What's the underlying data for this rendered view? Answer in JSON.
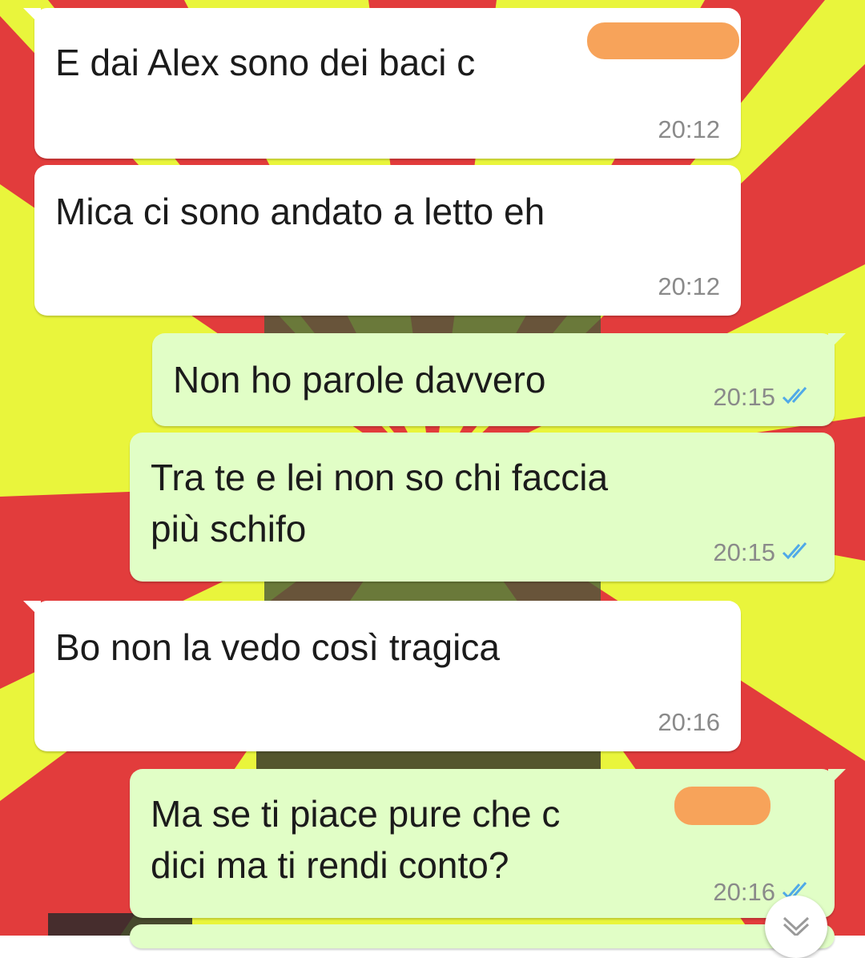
{
  "colors": {
    "wallpaper_yellow": "#e9f53c",
    "wallpaper_red": "#e23c3c",
    "incoming_bubble": "#ffffff",
    "outgoing_bubble": "#e1fec6",
    "read_ticks": "#4fa9e8",
    "redaction": "#f7a35a"
  },
  "messages": [
    {
      "direction": "incoming",
      "text": "E dai Alex sono dei baci c",
      "time": "20:12",
      "redacted": true
    },
    {
      "direction": "incoming",
      "text": "Mica ci sono andato a letto eh",
      "time": "20:12"
    },
    {
      "direction": "outgoing",
      "text": "Non ho parole davvero",
      "time": "20:15",
      "status": "read",
      "status_icon": "double-check-icon"
    },
    {
      "direction": "outgoing",
      "text": "Tra te e lei non so chi faccia\npiù schifo",
      "time": "20:15",
      "status": "read",
      "status_icon": "double-check-icon"
    },
    {
      "direction": "incoming",
      "text": "Bo non la vedo così tragica",
      "time": "20:16"
    },
    {
      "direction": "outgoing",
      "text": "Ma se ti piace pure che c\ndici ma ti rendi conto?",
      "time": "20:16",
      "status": "read",
      "status_icon": "double-check-icon",
      "redacted": true
    }
  ],
  "scroll_button": {
    "icon": "chevron-down-icon"
  }
}
